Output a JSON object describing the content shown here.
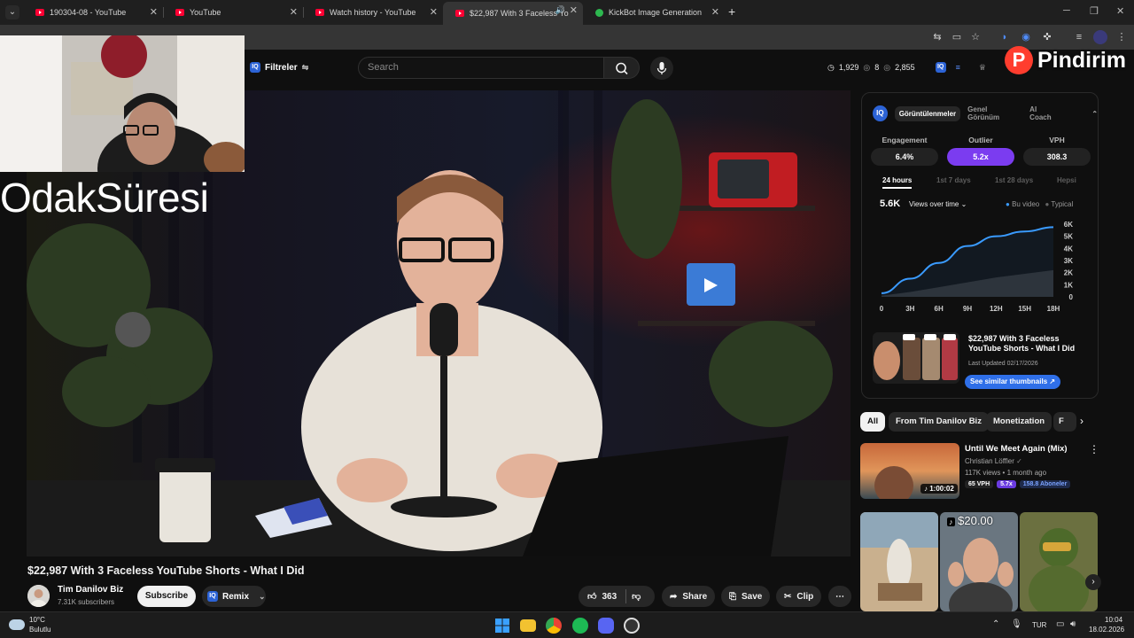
{
  "browser": {
    "tabs": [
      {
        "title": "190304-08 - YouTube",
        "active": false
      },
      {
        "title": "YouTube",
        "active": false
      },
      {
        "title": "Watch history - YouTube",
        "active": false
      },
      {
        "title": "$22,987 With 3 Faceless Yo",
        "active": true
      },
      {
        "title": "KickBot Image Generation",
        "active": false
      }
    ],
    "new_tab": "+",
    "menu_glyph": "⌄",
    "close_glyph": "✕"
  },
  "youtube": {
    "filters_label": "Filtreler",
    "search_placeholder": "Search",
    "stats": {
      "views": "1,929",
      "likes": "8",
      "subs": "2,855"
    }
  },
  "overlay": {
    "label": "OdakSüresi",
    "watermark_letter": "P",
    "watermark_text": "Pindirim"
  },
  "video": {
    "title": "$22,987 With 3 Faceless YouTube Shorts - What I Did",
    "channel": "Tim Danilov Biz",
    "subscribers": "7.31K subscribers",
    "subscribe_label": "Subscribe",
    "remix_label": "Remix",
    "likes": "363",
    "share_label": "Share",
    "save_label": "Save",
    "clip_label": "Clip"
  },
  "panel": {
    "tabs": [
      "Görüntülenmeler",
      "Genel Görünüm",
      "AI Coach"
    ],
    "metrics": [
      {
        "label": "Engagement",
        "value": "6.4%"
      },
      {
        "label": "Outlier",
        "value": "5.2x"
      },
      {
        "label": "VPH",
        "value": "308.3"
      }
    ],
    "ranges": [
      "24 hours",
      "1st 7 days",
      "1st 28 days",
      "Hepsi"
    ],
    "views_total": "5.6K",
    "views_select": "Views over time",
    "legend_this": "Bu video",
    "legend_typical": "Typical",
    "card_title": "$22,987 With 3 Faceless YouTube Shorts - What I Did",
    "card_date": "Last Updated 02/17/2026",
    "card_button": "See similar thumbnails ↗"
  },
  "chart_data": {
    "type": "area",
    "x": [
      "0",
      "3H",
      "6H",
      "9H",
      "12H",
      "15H",
      "18H"
    ],
    "xlabel": "",
    "ylabel": "",
    "yticks": [
      "0",
      "1K",
      "2K",
      "3K",
      "4K",
      "5K",
      "6K"
    ],
    "ylim": [
      0,
      6000
    ],
    "series": [
      {
        "name": "Bu video",
        "values": [
          300,
          1500,
          2800,
          4200,
          5000,
          5400,
          5750
        ]
      },
      {
        "name": "Typical",
        "values": [
          100,
          400,
          800,
          1200,
          1600,
          1900,
          2200
        ]
      }
    ]
  },
  "recommendations": {
    "chips": [
      "All",
      "From Tim Danilov Biz",
      "Monetization",
      "F"
    ],
    "rec1": {
      "title": "Until We Meet Again (Mix)",
      "channel": "Christian Löffler",
      "meta": "117K views • 1 month ago",
      "duration": "1:00:02",
      "vph": "65 VPH",
      "outlier": "5.7x",
      "subs": "158.8 Aboneler"
    },
    "short_price": "$20.00"
  },
  "taskbar": {
    "temp": "10°C",
    "weather": "Bulutlu",
    "lang": "TUR",
    "time": "10:04",
    "date": "18.02.2026"
  }
}
